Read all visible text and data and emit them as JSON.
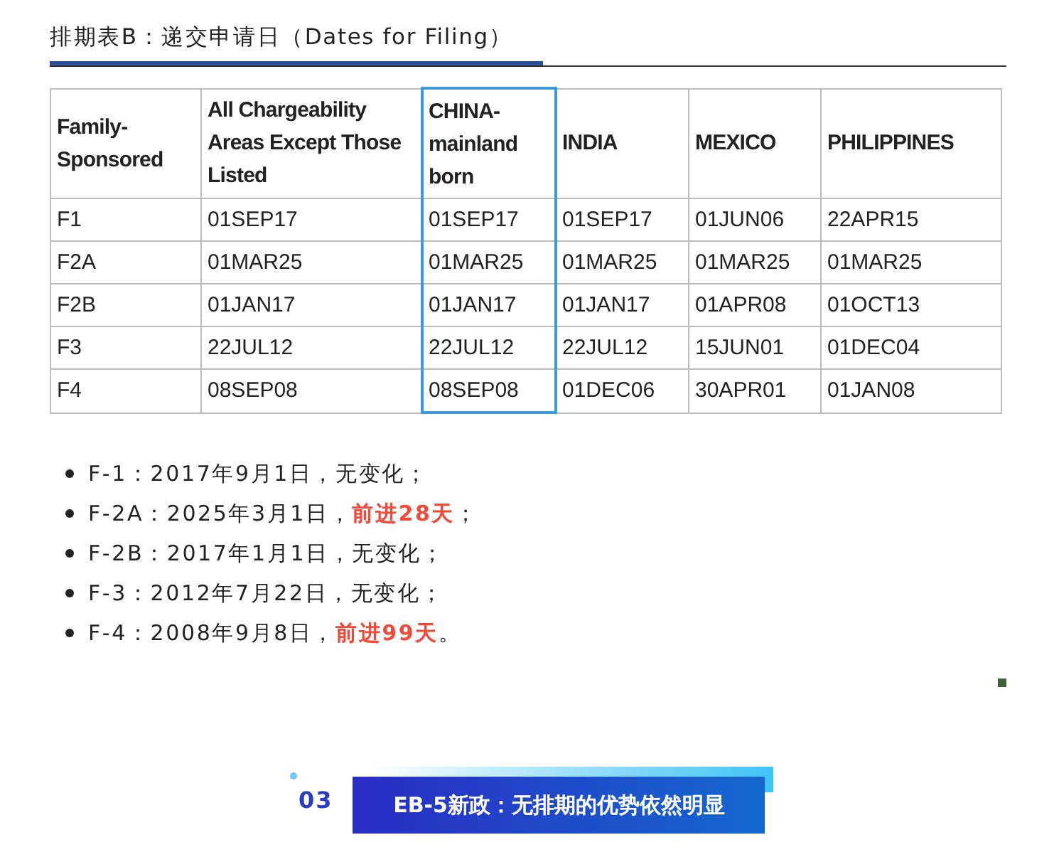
{
  "section_title": "排期表B：递交申请日（Dates for Filing）",
  "table": {
    "columns": [
      {
        "label": "Family-Sponsored",
        "highlighted": false
      },
      {
        "label": "All Chargeability Areas Except Those Listed",
        "highlighted": false
      },
      {
        "label": "CHINA-mainland born",
        "highlighted": true
      },
      {
        "label": "INDIA",
        "highlighted": false
      },
      {
        "label": "MEXICO",
        "highlighted": false
      },
      {
        "label": "PHILIPPINES",
        "highlighted": false
      }
    ],
    "rows": [
      [
        "F1",
        "01SEP17",
        "01SEP17",
        "01SEP17",
        "01JUN06",
        "22APR15"
      ],
      [
        "F2A",
        "01MAR25",
        "01MAR25",
        "01MAR25",
        "01MAR25",
        "01MAR25"
      ],
      [
        "F2B",
        "01JAN17",
        "01JAN17",
        "01JAN17",
        "01APR08",
        "01OCT13"
      ],
      [
        "F3",
        "22JUL12",
        "22JUL12",
        "22JUL12",
        "15JUN01",
        "01DEC04"
      ],
      [
        "F4",
        "08SEP08",
        "08SEP08",
        "01DEC06",
        "30APR01",
        "01JAN08"
      ]
    ]
  },
  "notes": [
    "F-1：2017年9月1日，无变化；",
    "F-2A：2025年3月1日，**前进28天**；",
    "F-2B：2017年1月1日，无变化；",
    "F-3：2012年7月22日，无变化；",
    "F-4：2008年9月8日，**前进99天**。"
  ],
  "next_section": {
    "number": "03",
    "title": "EB-5新政：无排期的优势依然明显"
  }
}
